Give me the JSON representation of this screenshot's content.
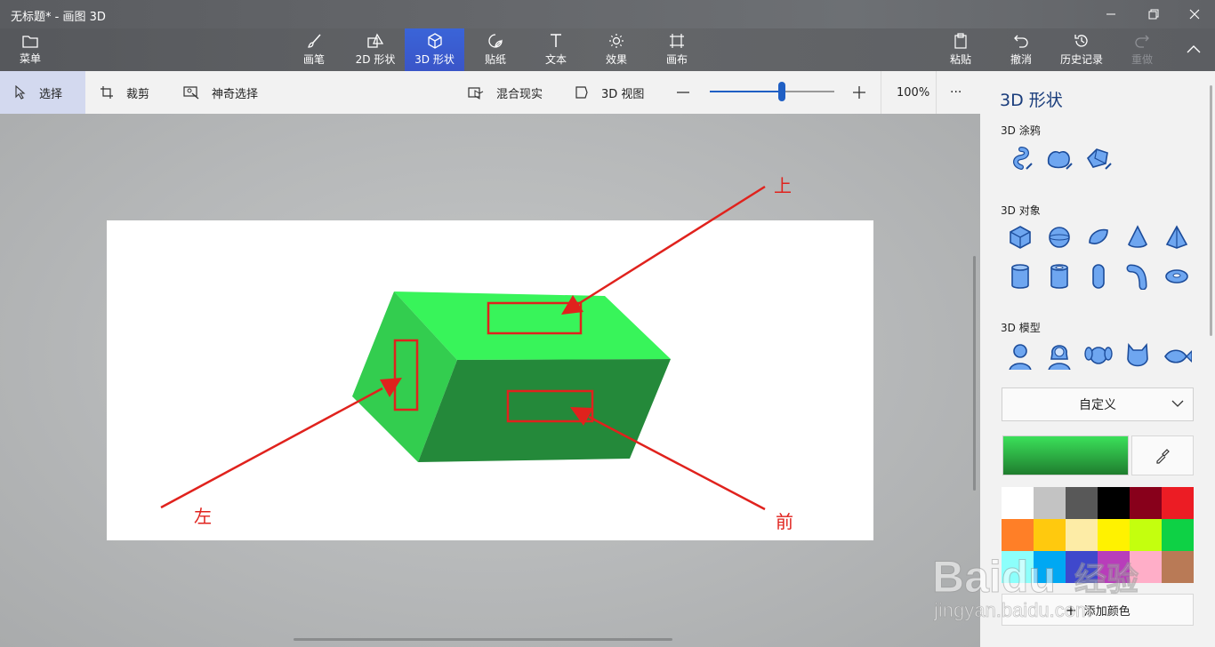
{
  "window": {
    "title": "无标题* - 画图 3D"
  },
  "ribbon": {
    "menu": "菜单",
    "tools": [
      "画笔",
      "2D 形状",
      "3D 形状",
      "贴纸",
      "文本",
      "效果",
      "画布"
    ],
    "right": [
      "粘贴",
      "撤消",
      "历史记录",
      "重做"
    ]
  },
  "toolbar": {
    "select": "选择",
    "crop": "裁剪",
    "magic_select": "神奇选择",
    "mixed_reality": "混合现实",
    "view3d": "3D 视图",
    "zoom_value": 0.58,
    "zoom": "100%",
    "more": "···"
  },
  "canvas": {
    "annotations": {
      "top": "上",
      "left": "左",
      "front": "前"
    },
    "box_colors": {
      "top": "#38f45a",
      "left": "#33cd4f",
      "front": "#24893a"
    },
    "marker_color": "#e0221d"
  },
  "panel": {
    "title": "3D 形状",
    "doodle_section": "3D 涂鸦",
    "objects_section": "3D 对象",
    "models_section": "3D 模型",
    "dropdown": "自定义",
    "current_color": "#2fb544",
    "palette": [
      "#ffffff",
      "#c3c3c3",
      "#585858",
      "#000000",
      "#88001b",
      "#ec1c24",
      "#ff7f27",
      "#ffc90e",
      "#fdeca6",
      "#fff200",
      "#c4ff0e",
      "#0ed145",
      "#8cfffb",
      "#00a8f3",
      "#3f48cc",
      "#b83dba",
      "#ffaec8",
      "#b97a56"
    ],
    "add_color": "添加颜色"
  },
  "watermark": {
    "brand": "Baidu",
    "cn": "经验",
    "url": "jingyan.baidu.com"
  }
}
